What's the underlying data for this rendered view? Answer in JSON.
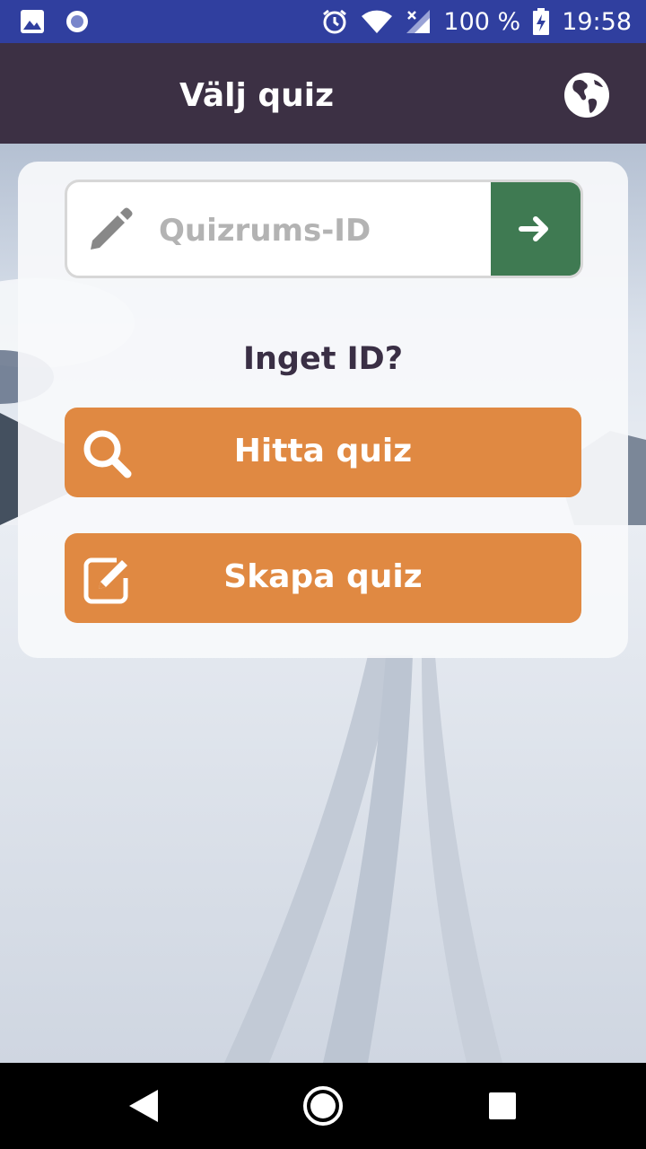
{
  "status_bar": {
    "battery": "100 %",
    "time": "19:58",
    "icons": [
      "image-icon",
      "record-icon",
      "alarm-icon",
      "wifi-icon",
      "signal-icon",
      "battery-charging-icon"
    ]
  },
  "appbar": {
    "title": "Välj quiz",
    "language_icon": "globe-icon"
  },
  "join": {
    "placeholder": "Quizrums-ID",
    "value": "",
    "edit_icon": "pencil-icon",
    "submit_icon": "arrow-right-icon"
  },
  "no_id_label": "Inget ID?",
  "actions": {
    "find": {
      "label": "Hitta quiz",
      "icon": "search-icon"
    },
    "create": {
      "label": "Skapa quiz",
      "icon": "edit-square-icon"
    }
  },
  "nav": {
    "back_icon": "back-icon",
    "home_icon": "home-icon",
    "recents_icon": "recents-icon"
  },
  "colors": {
    "status_bar": "#303f9f",
    "app_bar": "#3c3044",
    "go_button": "#3f7a52",
    "action_button": "#e08942",
    "heading_text": "#3a2f45"
  }
}
